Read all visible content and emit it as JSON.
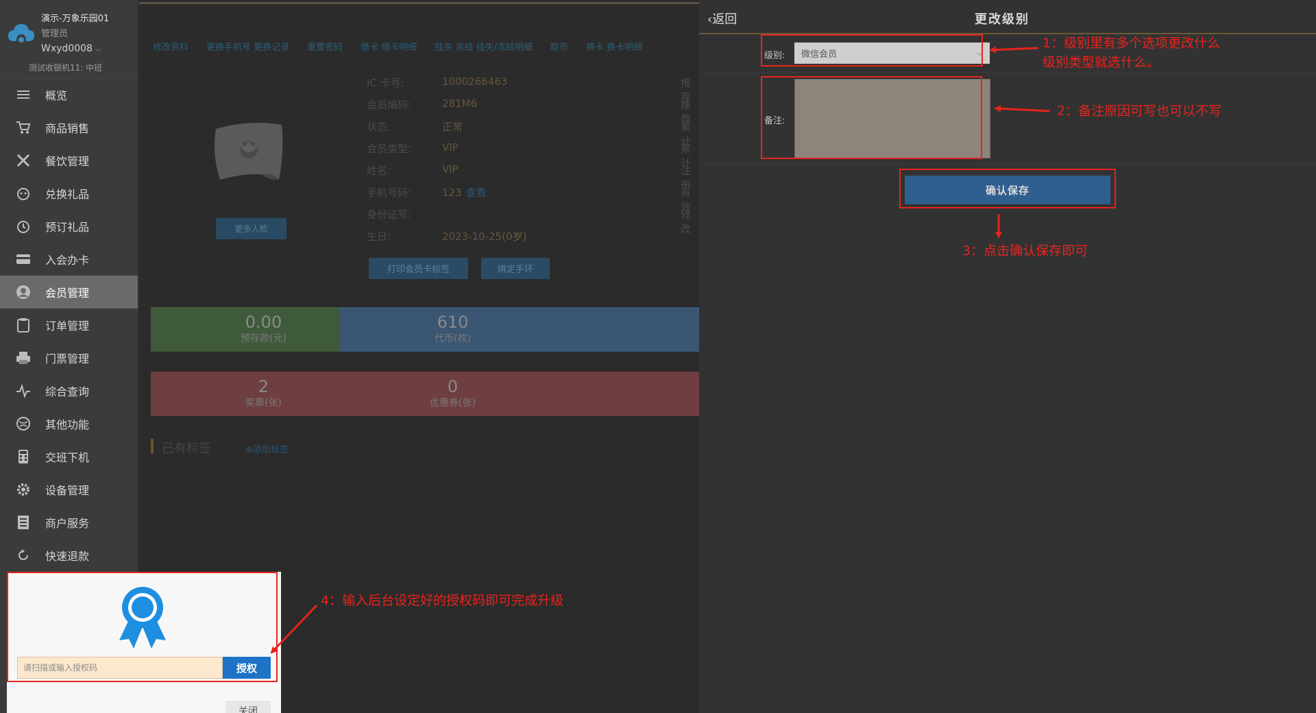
{
  "sidebar": {
    "store_name": "演示-万象乐园01",
    "role": "管理员",
    "username": "Wxyd0008",
    "device": "测试收银机11: 中班",
    "items": [
      {
        "label": "概览",
        "icon": "menu-icon"
      },
      {
        "label": "商品销售",
        "icon": "cart-icon"
      },
      {
        "label": "餐饮管理",
        "icon": "fork-knife-icon"
      },
      {
        "label": "兑换礼品",
        "icon": "gift-icon"
      },
      {
        "label": "预订礼品",
        "icon": "alarm-clock-icon"
      },
      {
        "label": "入会办卡",
        "icon": "card-icon"
      },
      {
        "label": "会员管理",
        "icon": "user-icon",
        "active": true
      },
      {
        "label": "订单管理",
        "icon": "clipboard-icon"
      },
      {
        "label": "门票管理",
        "icon": "printer-icon"
      },
      {
        "label": "综合查询",
        "icon": "pulse-icon"
      },
      {
        "label": "其他功能",
        "icon": "globe-icon"
      },
      {
        "label": "交班下机",
        "icon": "calculator-icon"
      },
      {
        "label": "设备管理",
        "icon": "gear-icon"
      },
      {
        "label": "商户服务",
        "icon": "document-icon"
      },
      {
        "label": "快速退款",
        "icon": "refresh-icon"
      }
    ]
  },
  "member": {
    "tabs": [
      "修改资料",
      "更换手机号 更换记录",
      "重置密码",
      "借卡 借卡明细",
      "挂失 冻结 挂失/冻结明细",
      "取币",
      "换卡 换卡明细"
    ],
    "fields": [
      {
        "k": "IC 卡号:",
        "v": "1000266463"
      },
      {
        "k": "会员编码:",
        "v": "281M6"
      },
      {
        "k": "状态:",
        "v": "正常"
      },
      {
        "k": "会员类型:",
        "v": "VIP"
      },
      {
        "k": "姓名:",
        "v": "VIP"
      },
      {
        "k": "手机号码:",
        "v": "123",
        "link": "查看"
      },
      {
        "k": "身份证号:",
        "v": ""
      },
      {
        "k": "生日:",
        "v": "2023-10-25",
        "age": "(0岁)"
      }
    ],
    "right_labels": [
      "推荐",
      "推荐",
      "累计",
      "累计",
      "注册",
      "有效",
      "修改"
    ],
    "more_face_btn": "更多人脸",
    "print_label_btn": "打印会员卡标签",
    "bind_wristband_btn": "绑定手环",
    "stats_row1": [
      {
        "value": "0.00",
        "label": "预存款(元)"
      },
      {
        "value": "610",
        "label": "代币(枚)"
      },
      {
        "value": "",
        "label": ""
      }
    ],
    "stats_row2": [
      {
        "value": "2",
        "label": "奖票(张)"
      },
      {
        "value": "0",
        "label": "优惠券(张)"
      },
      {
        "value": "",
        "label": ""
      }
    ],
    "tag_title": "已有标签",
    "add_tag": "添加标签"
  },
  "panel": {
    "back_label": "返回",
    "title": "更改级别",
    "level_label": "级别:",
    "level_value": "微信会员",
    "remark_label": "备注:",
    "save_label": "确认保存"
  },
  "auth_popup": {
    "placeholder": "请扫描或输入授权码",
    "auth_btn": "授权",
    "close_btn": "关闭"
  },
  "annotations": {
    "note1_line1": "1：级别里有多个选项更改什么",
    "note1_line2": "级别类型就选什么。",
    "note2": "2：备注原因可写也可以不写",
    "note3": "3：点击确认保存即可",
    "note4": "4：输入后台设定好的授权码即可完成升级"
  },
  "colors": {
    "accent_red": "#e8231d",
    "save_blue": "#2f5f8e",
    "auth_blue": "#1e73c7",
    "stat_green": "#3f5a3a",
    "stat_blue": "#3a5672",
    "stat_red": "#6e3e40"
  }
}
